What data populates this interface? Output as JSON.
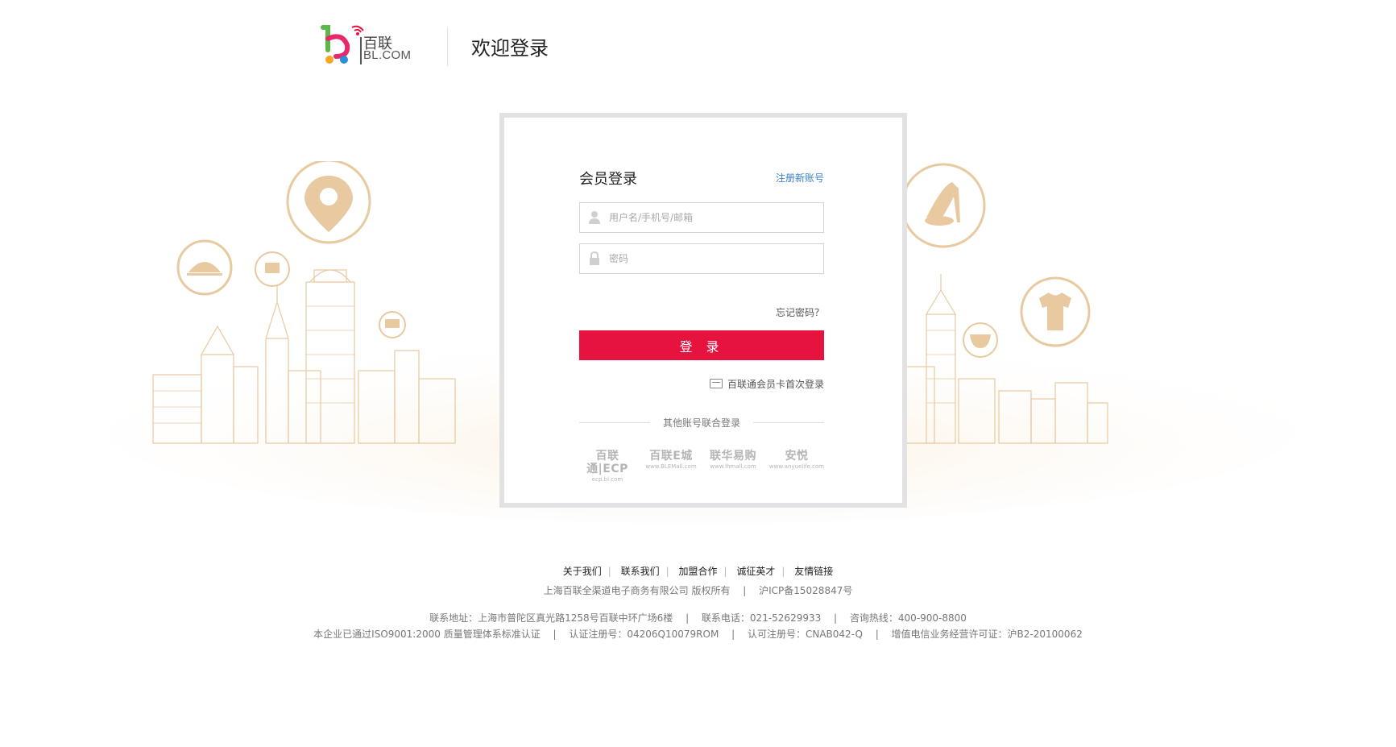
{
  "header": {
    "logo_cn": "百联",
    "logo_en": "BL.COM",
    "title": "欢迎登录"
  },
  "login": {
    "title": "会员登录",
    "register_link": "注册新账号",
    "username_placeholder": "用户名/手机号/邮箱",
    "password_placeholder": "密码",
    "forgot": "忘记密码？",
    "submit": "登 录",
    "card_login": "百联通会员卡首次登录",
    "other_accounts": "其他账号联合登录",
    "partners": [
      {
        "name": "百联通|ECP",
        "url": "ecp.bl.com"
      },
      {
        "name": "百联E城",
        "url": "www.BLEMall.com"
      },
      {
        "name": "联华易购",
        "url": "www.lhmall.com"
      },
      {
        "name": "安悦",
        "url": "www.anyuelife.com"
      }
    ]
  },
  "footer": {
    "links": [
      "关于我们",
      "联系我们",
      "加盟合作",
      "诚征英才",
      "友情链接"
    ],
    "copyright": "上海百联全渠道电子商务有限公司 版权所有　 |　 沪ICP备15028847号",
    "contact": "联系地址：上海市普陀区真光路1258号百联中环广场6楼　 |　 联系电话：021-52629933　 |　 咨询热线：400-900-8800",
    "cert": "本企业已通过ISO9001:2000 质量管理体系标准认证　 |　 认证注册号：04206Q10079ROM　 |　 认可注册号：CNAB042-Q　 |　 增值电信业务经营许可证：沪B2-20100062"
  },
  "colors": {
    "accent": "#e5133e",
    "link": "#3b82c4",
    "illustration": "#e8c9a0"
  }
}
